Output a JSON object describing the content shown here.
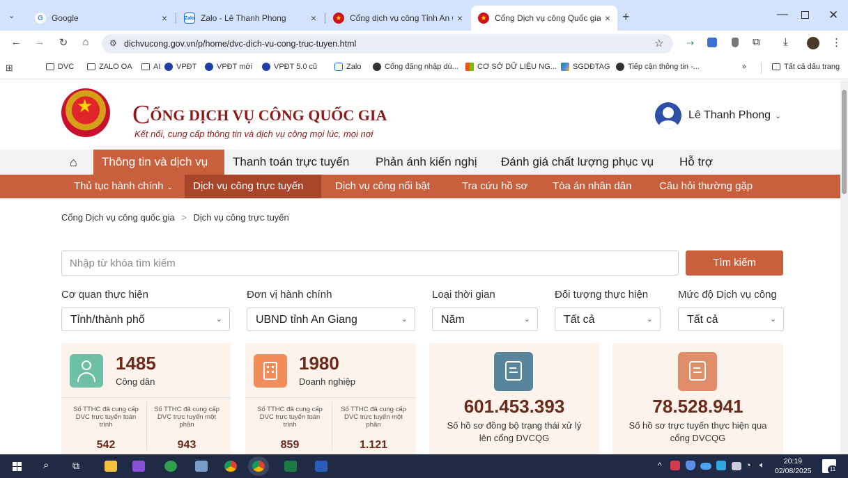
{
  "browser": {
    "tabs": [
      {
        "label": "Google",
        "icon": "google-icon",
        "color": "#4285f4",
        "active": false
      },
      {
        "label": "Zalo - Lê Thanh Phong",
        "icon": "zalo-icon",
        "color": "#0068ff",
        "active": false
      },
      {
        "label": "Cổng dịch vụ công Tỉnh An Giang",
        "icon": "emblem-icon",
        "color": "#d0121c",
        "active": false
      },
      {
        "label": "Cổng Dịch vụ công Quốc gia",
        "icon": "emblem-icon",
        "color": "#d0121c",
        "active": true
      }
    ],
    "new_tab_label": "+",
    "url": "dichvucong.gov.vn/p/home/dvc-dich-vu-cong-truc-tuyen.html",
    "bookmarks": [
      {
        "label": "DVC",
        "icon": "folder-icon"
      },
      {
        "label": "ZALO OA",
        "icon": "folder-icon"
      },
      {
        "label": "AI",
        "icon": "folder-icon"
      },
      {
        "label": "VPĐT",
        "icon": "vpdt-icon"
      },
      {
        "label": "VPĐT mới",
        "icon": "vpdt-icon"
      },
      {
        "label": "VPĐT 5.0 cũ",
        "icon": "vpdt-icon"
      },
      {
        "label": "Zalo",
        "icon": "zalo-icon"
      },
      {
        "label": "Cổng đăng nhập dù...",
        "icon": "globe-icon"
      },
      {
        "label": "CƠ SỞ DỮ LIỆU NG...",
        "icon": "windows-icon"
      },
      {
        "label": "SGDĐTAG",
        "icon": "drive-icon"
      },
      {
        "label": "Tiếp cận thông tin -...",
        "icon": "globe-icon"
      }
    ],
    "bookmarks_more": "»",
    "all_bookmarks_label": "Tất cả dấu trang"
  },
  "site": {
    "title_initial": "C",
    "title_rest": "ỔNG DỊCH VỤ CÔNG QUỐC GIA",
    "subtitle": "Kết nối, cung cấp thông tin và dịch vụ công mọi lúc, mọi nơi",
    "user_name": "Lê Thanh Phong"
  },
  "main_menu": [
    {
      "label": "Thông tin và dịch vụ",
      "active": true
    },
    {
      "label": "Thanh toán trực tuyến",
      "active": false
    },
    {
      "label": "Phản ánh kiến nghị",
      "active": false
    },
    {
      "label": "Đánh giá chất lượng phục vụ",
      "active": false
    },
    {
      "label": "Hỗ trợ",
      "active": false
    }
  ],
  "sub_menu": [
    {
      "label": "Thủ tục hành chính",
      "active": false
    },
    {
      "label": "Dịch vụ công trực tuyến",
      "active": true
    },
    {
      "label": "Dịch vụ công nổi bật",
      "active": false
    },
    {
      "label": "Tra cứu hồ sơ",
      "active": false
    },
    {
      "label": "Tòa án nhân dân",
      "active": false
    },
    {
      "label": "Câu hỏi thường gặp",
      "active": false
    }
  ],
  "breadcrumb": {
    "home": "Cổng Dịch vụ công quốc gia",
    "sep": ">",
    "current": "Dịch vụ công trực tuyến"
  },
  "search": {
    "placeholder": "Nhập từ khóa tìm kiếm",
    "button": "Tìm kiếm"
  },
  "filters": [
    {
      "label": "Cơ quan thực hiện",
      "value": "Tỉnh/thành phố"
    },
    {
      "label": "Đơn vị hành chính",
      "value": "UBND tỉnh An Giang"
    },
    {
      "label": "Loại thời gian",
      "value": "Năm"
    },
    {
      "label": "Đối tượng thực hiện",
      "value": "Tất cả"
    },
    {
      "label": "Mức độ Dịch vụ công",
      "value": "Tất cả"
    }
  ],
  "stats": {
    "citizen": {
      "count": "1485",
      "label": "Công dân",
      "full_label": "Số TTHC đã cung cấp DVC trực tuyến toàn trình",
      "full_value": "542",
      "partial_label": "Số TTHC đã cung cấp DVC trực tuyến một phần",
      "partial_value": "943"
    },
    "business": {
      "count": "1980",
      "label": "Doanh nghiệp",
      "full_label": "Số TTHC đã cung cấp DVC trực tuyến toàn trình",
      "full_value": "859",
      "partial_label": "Số TTHC đã cung cấp DVC trực tuyến một phần",
      "partial_value": "1.121"
    },
    "synced": {
      "value": "601.453.393",
      "label": "Số hồ sơ đồng bộ trạng thái xử lý lên cổng DVCQG"
    },
    "online": {
      "value": "78.528.941",
      "label": "Số hồ sơ trực tuyến thực hiện qua cổng DVCQG"
    }
  },
  "taskbar": {
    "time": "20:19",
    "date": "02/08/2025",
    "notifications": "11"
  },
  "colors": {
    "accent": "#c8603d",
    "active_tab_bg": "#d3e3fd",
    "stat_dark": "#6b2a1a"
  }
}
